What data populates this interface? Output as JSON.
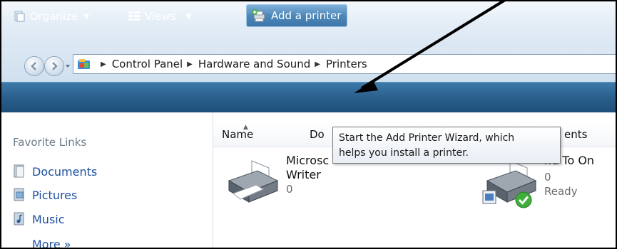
{
  "address": {
    "crumbs": [
      "Control Panel",
      "Hardware and Sound",
      "Printers"
    ]
  },
  "toolbar": {
    "organize_label": "Organize",
    "views_label": "Views",
    "add_printer_label": "Add a printer"
  },
  "sidebar": {
    "title": "Favorite Links",
    "items": [
      {
        "label": "Documents"
      },
      {
        "label": "Pictures"
      },
      {
        "label": "Music"
      },
      {
        "label": "More »"
      }
    ]
  },
  "columns": {
    "name": "Name",
    "docs_partial": "Do",
    "status_partial": "ents"
  },
  "printers": [
    {
      "name_line1": "Microsc",
      "name_line2": "Writer",
      "count": "0"
    },
    {
      "name_partial": "nd To On",
      "count": "0",
      "status": "Ready"
    }
  ],
  "tooltip": {
    "line1": "Start the Add Printer Wizard, which",
    "line2": "helps you install a printer."
  },
  "colors": {
    "toolbar": "#2a5f8c",
    "link": "#1e50a0",
    "annotation_arrow": "#000000"
  }
}
